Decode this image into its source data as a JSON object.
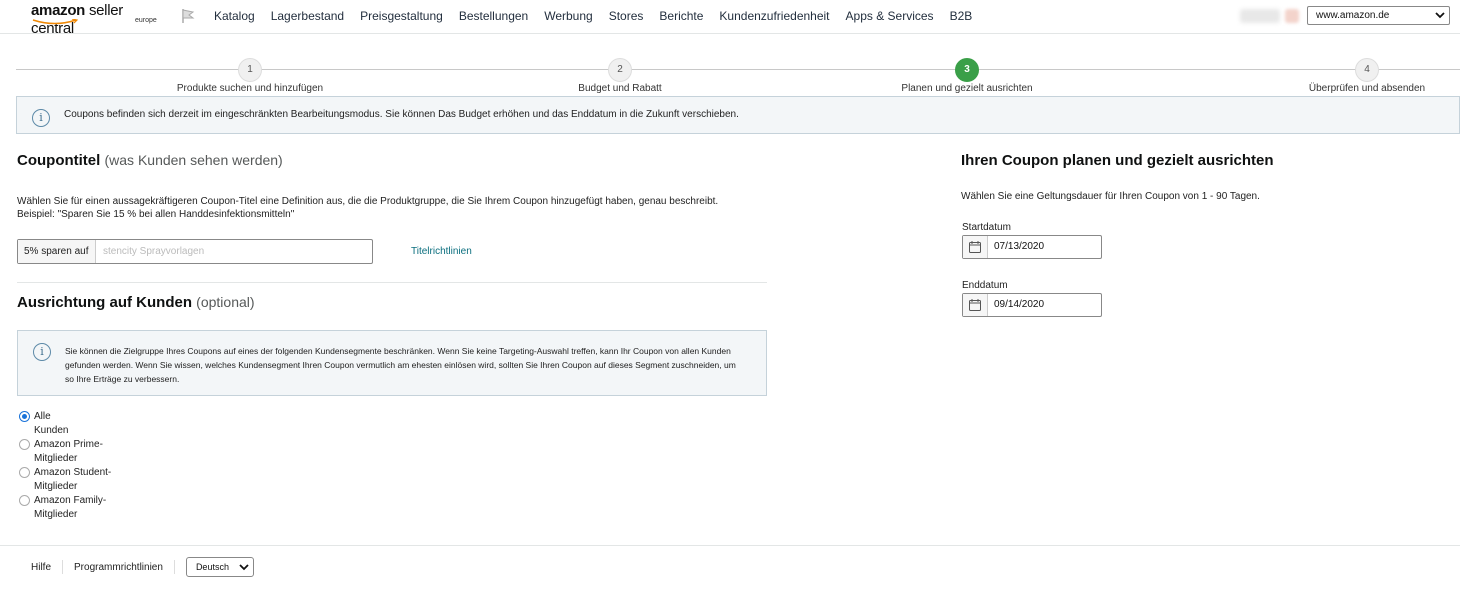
{
  "header": {
    "logo_brand": "amazon",
    "logo_text": "seller central",
    "logo_region": "europe",
    "nav": [
      "Katalog",
      "Lagerbestand",
      "Preisgestaltung",
      "Bestellungen",
      "Werbung",
      "Stores",
      "Berichte",
      "Kundenzufriedenheit",
      "Apps & Services",
      "B2B"
    ],
    "marketplace": "www.amazon.de"
  },
  "stepper": {
    "steps": [
      {
        "number": "1",
        "label": "Produkte suchen und hinzufügen"
      },
      {
        "number": "2",
        "label": "Budget und Rabatt"
      },
      {
        "number": "3",
        "label": "Planen und gezielt ausrichten"
      },
      {
        "number": "4",
        "label": "Überprüfen und absenden"
      }
    ],
    "active": 3
  },
  "banner": {
    "message": "Coupons befinden sich derzeit im eingeschränkten Bearbeitungsmodus. Sie können Das Budget erhöhen und das Enddatum in die Zukunft verschieben."
  },
  "coupon_title": {
    "heading": "Coupontitel",
    "heading_note": "(was Kunden sehen werden)",
    "description_line1": "Wählen Sie für einen aussagekräftigeren Coupon-Titel eine Definition aus, die die Produktgruppe, die Sie Ihrem Coupon hinzugefügt haben, genau beschreibt.",
    "description_line2": "Beispiel: \"Sparen Sie 15 % bei allen Handdesinfektionsmitteln\"",
    "prefix": "5% sparen auf",
    "value": "stencity Sprayvorlagen",
    "guidelines_link": "Titelrichtlinien"
  },
  "targeting": {
    "heading": "Ausrichtung auf Kunden",
    "heading_note": "(optional)",
    "info": "Sie können die Zielgruppe Ihres Coupons auf eines der folgenden Kundensegmente beschränken. Wenn Sie keine Targeting-Auswahl treffen, kann Ihr Coupon von allen Kunden gefunden werden. Wenn Sie wissen, welches Kundensegment Ihren Coupon vermutlich am ehesten einlösen wird, sollten Sie Ihren Coupon auf dieses Segment zuschneiden, um so Ihre Erträge zu verbessern.",
    "options": [
      {
        "line1": "Alle",
        "line2": "Kunden",
        "checked": true
      },
      {
        "line1": "Amazon Prime-",
        "line2": "Mitglieder",
        "checked": false
      },
      {
        "line1": "Amazon Student-",
        "line2": "Mitglieder",
        "checked": false
      },
      {
        "line1": "Amazon Family-",
        "line2": "Mitglieder",
        "checked": false
      }
    ]
  },
  "schedule": {
    "heading": "Ihren Coupon planen und gezielt ausrichten",
    "description": "Wählen Sie eine Geltungsdauer für Ihren Coupon von 1 - 90 Tagen.",
    "start_label": "Startdatum",
    "start_value": "07/13/2020",
    "end_label": "Enddatum",
    "end_value": "09/14/2020"
  },
  "footer": {
    "help": "Hilfe",
    "policies": "Programmrichtlinien",
    "language": "Deutsch"
  },
  "colors": {
    "active_step": "#3a9f48",
    "link": "#0a6e7e",
    "radio": "#1a73d9"
  }
}
